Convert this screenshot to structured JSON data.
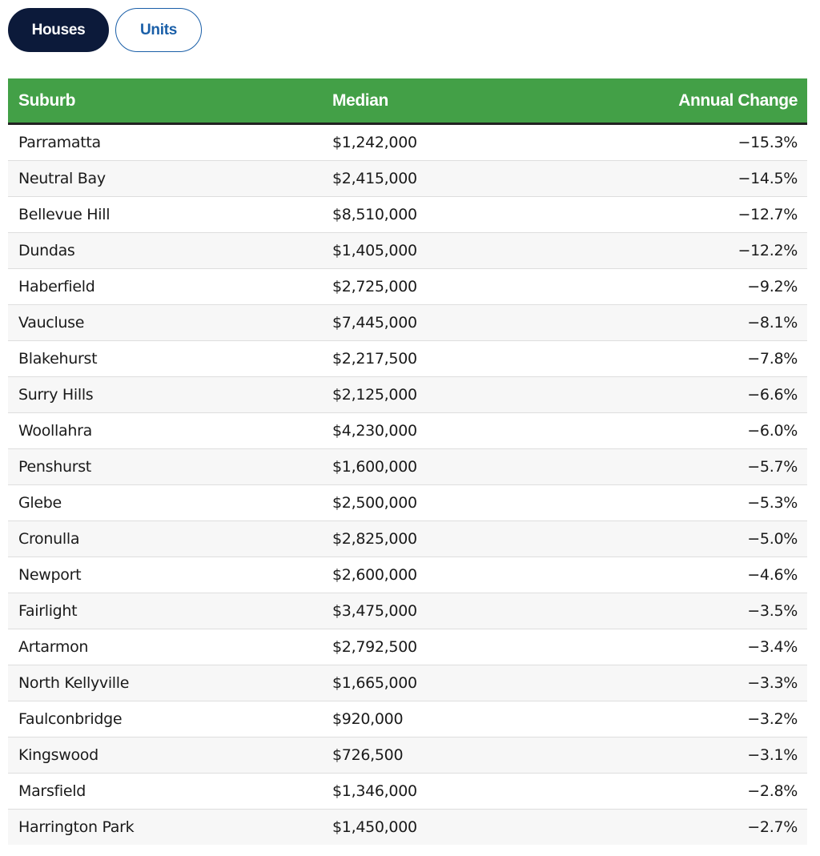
{
  "toggle": {
    "options": [
      {
        "label": "Houses",
        "active": true
      },
      {
        "label": "Units",
        "active": false
      }
    ]
  },
  "colors": {
    "header_bg": "#43a047",
    "header_border": "#222222",
    "active_toggle_bg": "#0c1a3a",
    "inactive_toggle_accent": "#1a5fa8",
    "zebra_row": "#f7f7f7"
  },
  "table": {
    "headers": {
      "suburb": "Suburb",
      "median": "Median",
      "change": "Annual Change"
    },
    "rows": [
      {
        "suburb": "Parramatta",
        "median": "$1,242,000",
        "change": "−15.3%"
      },
      {
        "suburb": "Neutral Bay",
        "median": "$2,415,000",
        "change": "−14.5%"
      },
      {
        "suburb": "Bellevue Hill",
        "median": "$8,510,000",
        "change": "−12.7%"
      },
      {
        "suburb": "Dundas",
        "median": "$1,405,000",
        "change": "−12.2%"
      },
      {
        "suburb": "Haberfield",
        "median": "$2,725,000",
        "change": "−9.2%"
      },
      {
        "suburb": "Vaucluse",
        "median": "$7,445,000",
        "change": "−8.1%"
      },
      {
        "suburb": "Blakehurst",
        "median": "$2,217,500",
        "change": "−7.8%"
      },
      {
        "suburb": "Surry Hills",
        "median": "$2,125,000",
        "change": "−6.6%"
      },
      {
        "suburb": "Woollahra",
        "median": "$4,230,000",
        "change": "−6.0%"
      },
      {
        "suburb": "Penshurst",
        "median": "$1,600,000",
        "change": "−5.7%"
      },
      {
        "suburb": "Glebe",
        "median": "$2,500,000",
        "change": "−5.3%"
      },
      {
        "suburb": "Cronulla",
        "median": "$2,825,000",
        "change": "−5.0%"
      },
      {
        "suburb": "Newport",
        "median": "$2,600,000",
        "change": "−4.6%"
      },
      {
        "suburb": "Fairlight",
        "median": "$3,475,000",
        "change": "−3.5%"
      },
      {
        "suburb": "Artarmon",
        "median": "$2,792,500",
        "change": "−3.4%"
      },
      {
        "suburb": "North Kellyville",
        "median": "$1,665,000",
        "change": "−3.3%"
      },
      {
        "suburb": "Faulconbridge",
        "median": "$920,000",
        "change": "−3.2%"
      },
      {
        "suburb": "Kingswood",
        "median": "$726,500",
        "change": "−3.1%"
      },
      {
        "suburb": "Marsfield",
        "median": "$1,346,000",
        "change": "−2.8%"
      },
      {
        "suburb": "Harrington Park",
        "median": "$1,450,000",
        "change": "−2.7%"
      }
    ]
  }
}
